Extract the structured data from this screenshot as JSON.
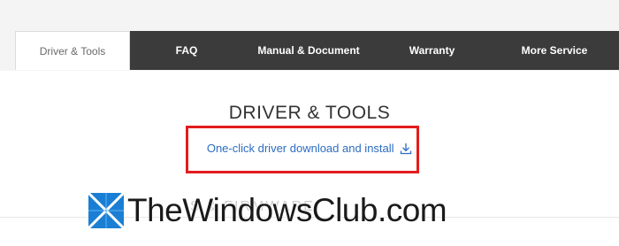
{
  "tabs": [
    {
      "label": "Driver & Tools",
      "active": true
    },
    {
      "label": "FAQ",
      "active": false
    },
    {
      "label": "Manual & Document",
      "active": false
    },
    {
      "label": "Warranty",
      "active": false
    },
    {
      "label": "More Service",
      "active": false
    }
  ],
  "section": {
    "title": "DRIVER & TOOLS",
    "download_link": "One-click driver download and install",
    "download_icon": "download-icon",
    "faded_subtitle": "S & FIRMWARE"
  },
  "watermark": {
    "text": "TheWindowsClub.com",
    "logo_icon": "windows-logo-icon"
  },
  "colors": {
    "tab_dark": "#3b3b3b",
    "link_blue": "#2b6dc2",
    "highlight_red": "#e21d1d",
    "watermark_blue": "#1a7fd4"
  }
}
